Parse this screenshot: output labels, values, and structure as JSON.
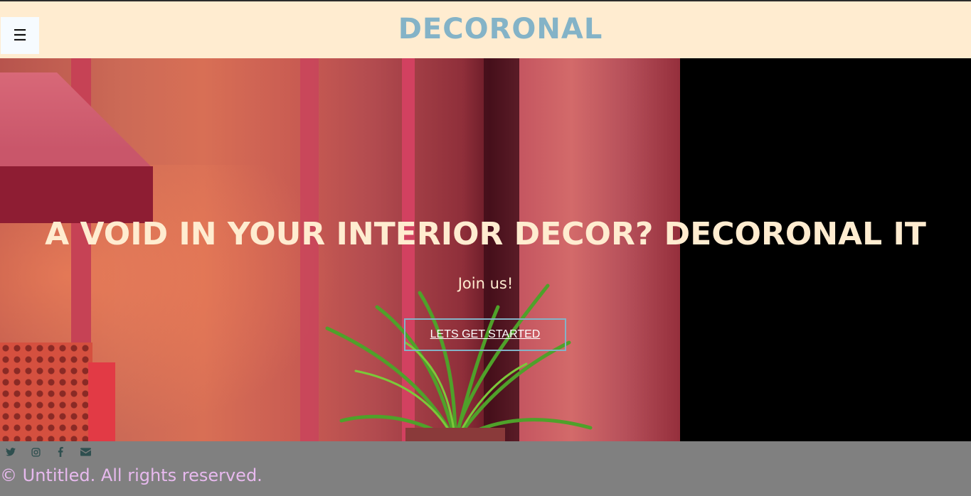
{
  "header": {
    "menu_icon": "☰",
    "brand": "DECORONAL"
  },
  "hero": {
    "title": "A VOID IN YOUR INTERIOR DECOR? DECORONAL IT",
    "subtitle": "Join us!",
    "cta_label": "LETS GET STARTED"
  },
  "footer": {
    "socials": [
      "twitter-icon",
      "instagram-icon",
      "facebook-icon",
      "email-icon"
    ],
    "copyright": "© Untitled. All rights reserved."
  },
  "colors": {
    "header_bg": "#ffecd0",
    "brand": "#84b3c7",
    "hero_text": "#ffecd0",
    "cta_border": "#84b3c7",
    "footer_bg": "#808080",
    "copyright": "#e7b9ee",
    "social_icon": "#2f4f4f"
  }
}
